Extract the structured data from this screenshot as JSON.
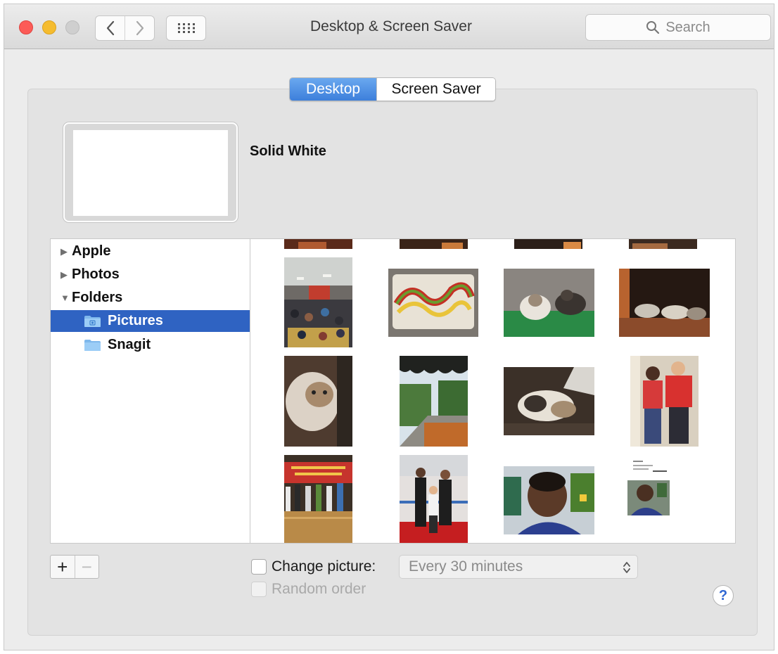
{
  "window": {
    "title": "Desktop & Screen Saver",
    "search_placeholder": "Search",
    "icons": {
      "back": "chevron-left-icon",
      "forward": "chevron-right-icon",
      "show_all": "grid-icon",
      "search": "magnifier-icon"
    }
  },
  "tabs": [
    {
      "label": "Desktop",
      "selected": true
    },
    {
      "label": "Screen Saver",
      "selected": false
    }
  ],
  "current_wallpaper": {
    "name": "Solid White",
    "preview_color": "#ffffff"
  },
  "sidebar": {
    "items": [
      {
        "label": "Apple",
        "expanded": false,
        "level": 0
      },
      {
        "label": "Photos",
        "expanded": false,
        "level": 0
      },
      {
        "label": "Folders",
        "expanded": true,
        "level": 0
      },
      {
        "label": "Pictures",
        "selected": true,
        "level": 1,
        "icon": "folder-icon"
      },
      {
        "label": "Snagit",
        "selected": false,
        "level": 1,
        "icon": "folder-icon"
      }
    ]
  },
  "thumbnails": [
    "photo-partial-1",
    "photo-partial-2",
    "photo-partial-3",
    "photo-partial-4",
    "classroom-photo",
    "dragon-cake-photo",
    "cat-on-blanket-photo",
    "two-cats-photo",
    "cat-closeup-photo",
    "garden-walkway-photo",
    "cat-lying-photo",
    "two-boys-photo",
    "stage-group-photo",
    "group-red-carpet-photo",
    "boy-portrait-photo",
    "document-with-photo"
  ],
  "controls": {
    "add_label": "+",
    "remove_label": "−",
    "change_picture_label": "Change picture:",
    "change_picture_checked": false,
    "interval_value": "Every 30 minutes",
    "random_order_label": "Random order",
    "random_order_enabled": false,
    "help_label": "?"
  },
  "colors": {
    "selection": "#2f63c2",
    "segment_selected": "#3d7fdb",
    "close": "#fc5b57",
    "minimize": "#f5bc2f",
    "zoom": "#cfcfcf"
  }
}
